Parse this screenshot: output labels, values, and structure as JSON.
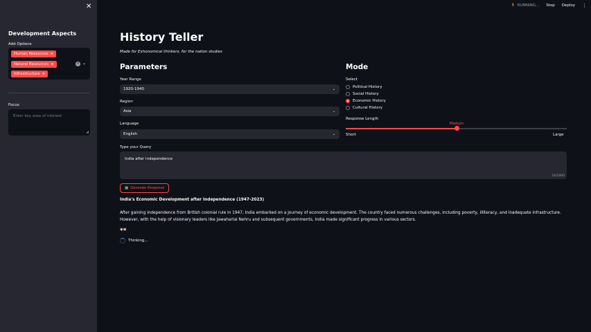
{
  "topbar": {
    "running": "RUNNING...",
    "stop": "Stop",
    "deploy": "Deploy"
  },
  "sidebar": {
    "title": "Development Aspects",
    "add_options_label": "Add Options",
    "tags": [
      "Human Resources",
      "Natural Resources",
      "Infrastructure"
    ],
    "focus_label": "Focus",
    "focus_placeholder": "Enter key area of interest"
  },
  "main": {
    "title": "History Teller",
    "subtitle": "Made for Exhonomical thinkers, for the nation studies",
    "parameters_heading": "Parameters",
    "year_range_label": "Year Range",
    "year_range_value": "1920-1940",
    "region_label": "Region",
    "region_value": "Asia",
    "language_label": "Language",
    "language_value": "English",
    "query_label": "Type your Query",
    "query_value": "India after independence",
    "query_count": "24/1000",
    "generate_label": "Generate Response",
    "response_title": "India's Economic Development after Independence (1947-2023)",
    "response_body": "After gaining independence from British colonial rule in 1947, India embarked on a journey of economic development. The country faced numerous challenges, including poverty, illiteracy, and inadequate infrastructure. However, with the help of visionary leaders like Jawaharlal Nehru and subsequent governments, India made significant progress in various sectors.",
    "cursor_mark": "**",
    "thinking": "Thinking..."
  },
  "mode": {
    "heading": "Mode",
    "select_label": "Select",
    "options": [
      "Political History",
      "Social History",
      "Economic History",
      "Cultural History"
    ],
    "selected": "Economic History",
    "length_label": "Response Length",
    "length_value": "Medium",
    "length_fraction": 0.5,
    "short_label": "Short",
    "large_label": "Large"
  },
  "colors": {
    "accent": "#ff4b4b",
    "background": "#0e1117",
    "panel": "#262730"
  }
}
